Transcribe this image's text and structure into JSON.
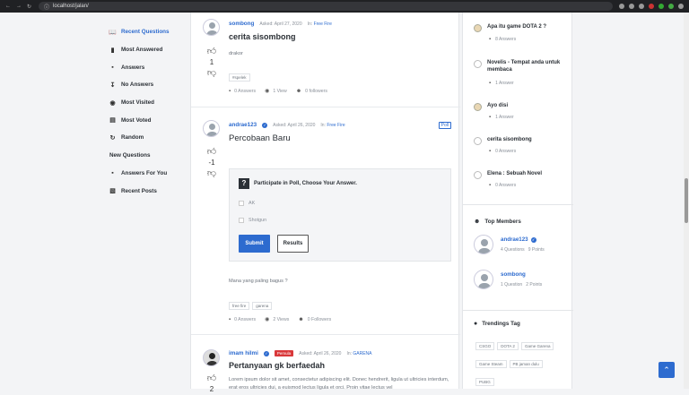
{
  "browser": {
    "url": "localhost/jalan/"
  },
  "leftnav": [
    {
      "label": "Recent Questions",
      "icon": "book-icon",
      "active": true
    },
    {
      "label": "Most Answered",
      "icon": "chat-bubbles-icon"
    },
    {
      "label": "Answers",
      "icon": "comment-icon"
    },
    {
      "label": "No Answers",
      "icon": "download-icon"
    },
    {
      "label": "Most Visited",
      "icon": "eye-icon"
    },
    {
      "label": "Most Voted",
      "icon": "chart-icon"
    },
    {
      "label": "Random",
      "icon": "refresh-icon"
    },
    {
      "label": "New Questions",
      "icon": ""
    },
    {
      "label": "Answers For You",
      "icon": "comment-icon"
    },
    {
      "label": "Recent Posts",
      "icon": "document-icon"
    }
  ],
  "posts": [
    {
      "author": "sombong",
      "asked": "Asked: April 27, 2020",
      "in_prefix": "In:",
      "category": "Free Fire",
      "title": "cerita sisombong",
      "votes": "1",
      "excerpt": "drakor",
      "tags": [
        "#spelek"
      ],
      "answers": "0 Answers",
      "views": "1 View",
      "followers": "0 followers"
    },
    {
      "author": "andrae123",
      "asked": "Asked: April 26, 2020",
      "in_prefix": "In:",
      "category": "Free Fire",
      "poll_label": "Poll",
      "title": "Percobaan Baru",
      "votes": "-1",
      "poll": {
        "question": "Participate in Poll, Choose Your Answer.",
        "options": [
          "AK",
          "Shotgun"
        ],
        "submit": "Submit",
        "results": "Results"
      },
      "excerpt": "Mana yang paling bagus ?",
      "tags": [
        "free fire",
        "garena"
      ],
      "answers": "0 Answers",
      "views": "2 Views",
      "followers": "0 Followers"
    },
    {
      "author": "imam hilmi",
      "badge": "Pemula",
      "asked": "Asked: April 26, 2020",
      "in_prefix": "In:",
      "category": "GARENA",
      "title": "Pertanyaan gk berfaedah",
      "votes": "2",
      "excerpt": "Lorem ipsum dolor sit amet, consectetur adipiscing elit. Donec hendrerit, ligula ut ultricies interdum, erat eros ultricies dui, a euismod lectus ligula et orci. Proin vitae lectus vel"
    }
  ],
  "sidebar_questions": [
    {
      "title": "Apa itu game DOTA 2 ?",
      "answers": "8 Answers"
    },
    {
      "title": "Novelis - Tempat anda untuk membaca",
      "answers": "1 Answer"
    },
    {
      "title": "Ayo disi",
      "answers": "1 Answer"
    },
    {
      "title": "cerita sisombong",
      "answers": "0 Answers"
    },
    {
      "title": "Elena : Sebuah Novel",
      "answers": "0 Answers"
    }
  ],
  "top_members": {
    "heading": "Top Members",
    "members": [
      {
        "name": "andrae123",
        "questions": "4 Questions",
        "points": "9 Points"
      },
      {
        "name": "sombong",
        "questions": "1 Question",
        "points": "2 Points"
      }
    ]
  },
  "trending": {
    "heading": "Trendings Tag",
    "tags": [
      "CSGO",
      "DOTA 2",
      "Game Garena",
      "Game Steam",
      "PB jaman dulu",
      "PUBG"
    ]
  },
  "colors": {
    "accent": "#2d6bcf",
    "badge": "#d9383a"
  }
}
